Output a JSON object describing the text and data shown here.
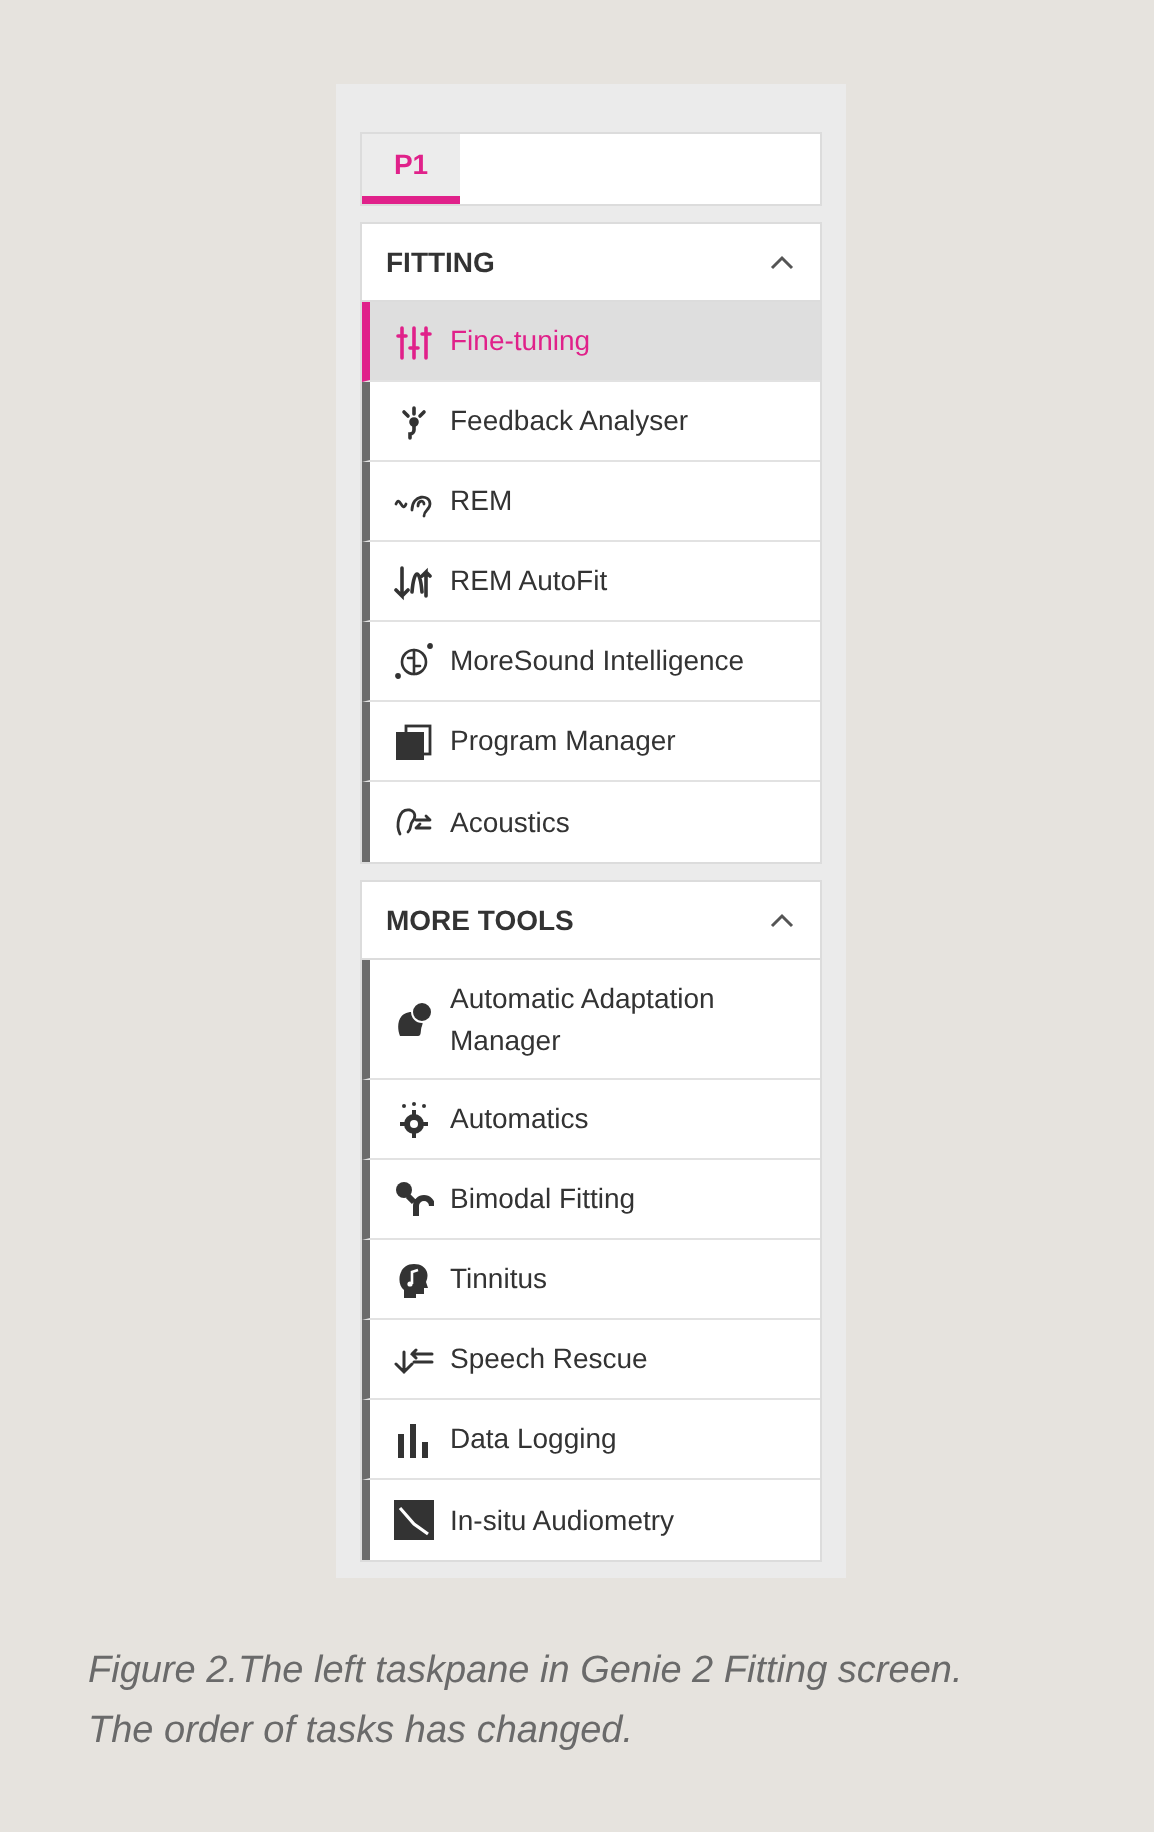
{
  "tabs": [
    {
      "label": "P1",
      "selected": true
    }
  ],
  "sections": [
    {
      "title": "FITTING",
      "expanded": true,
      "items": [
        {
          "label": "Fine-tuning",
          "selected": true
        },
        {
          "label": "Feedback Analyser",
          "selected": false
        },
        {
          "label": "REM",
          "selected": false
        },
        {
          "label": "REM AutoFit",
          "selected": false
        },
        {
          "label": "MoreSound Intelligence",
          "selected": false
        },
        {
          "label": "Program Manager",
          "selected": false
        },
        {
          "label": "Acoustics",
          "selected": false
        }
      ]
    },
    {
      "title": "MORE TOOLS",
      "expanded": true,
      "items": [
        {
          "label": "Automatic Adaptation Manager",
          "selected": false
        },
        {
          "label": "Automatics",
          "selected": false
        },
        {
          "label": "Bimodal Fitting",
          "selected": false
        },
        {
          "label": "Tinnitus",
          "selected": false
        },
        {
          "label": "Speech Rescue",
          "selected": false
        },
        {
          "label": "Data Logging",
          "selected": false
        },
        {
          "label": "In-situ Audiometry",
          "selected": false
        }
      ]
    }
  ],
  "caption": "Figure 2.The left taskpane in Genie 2 Fitting screen.\nThe order of tasks has changed."
}
